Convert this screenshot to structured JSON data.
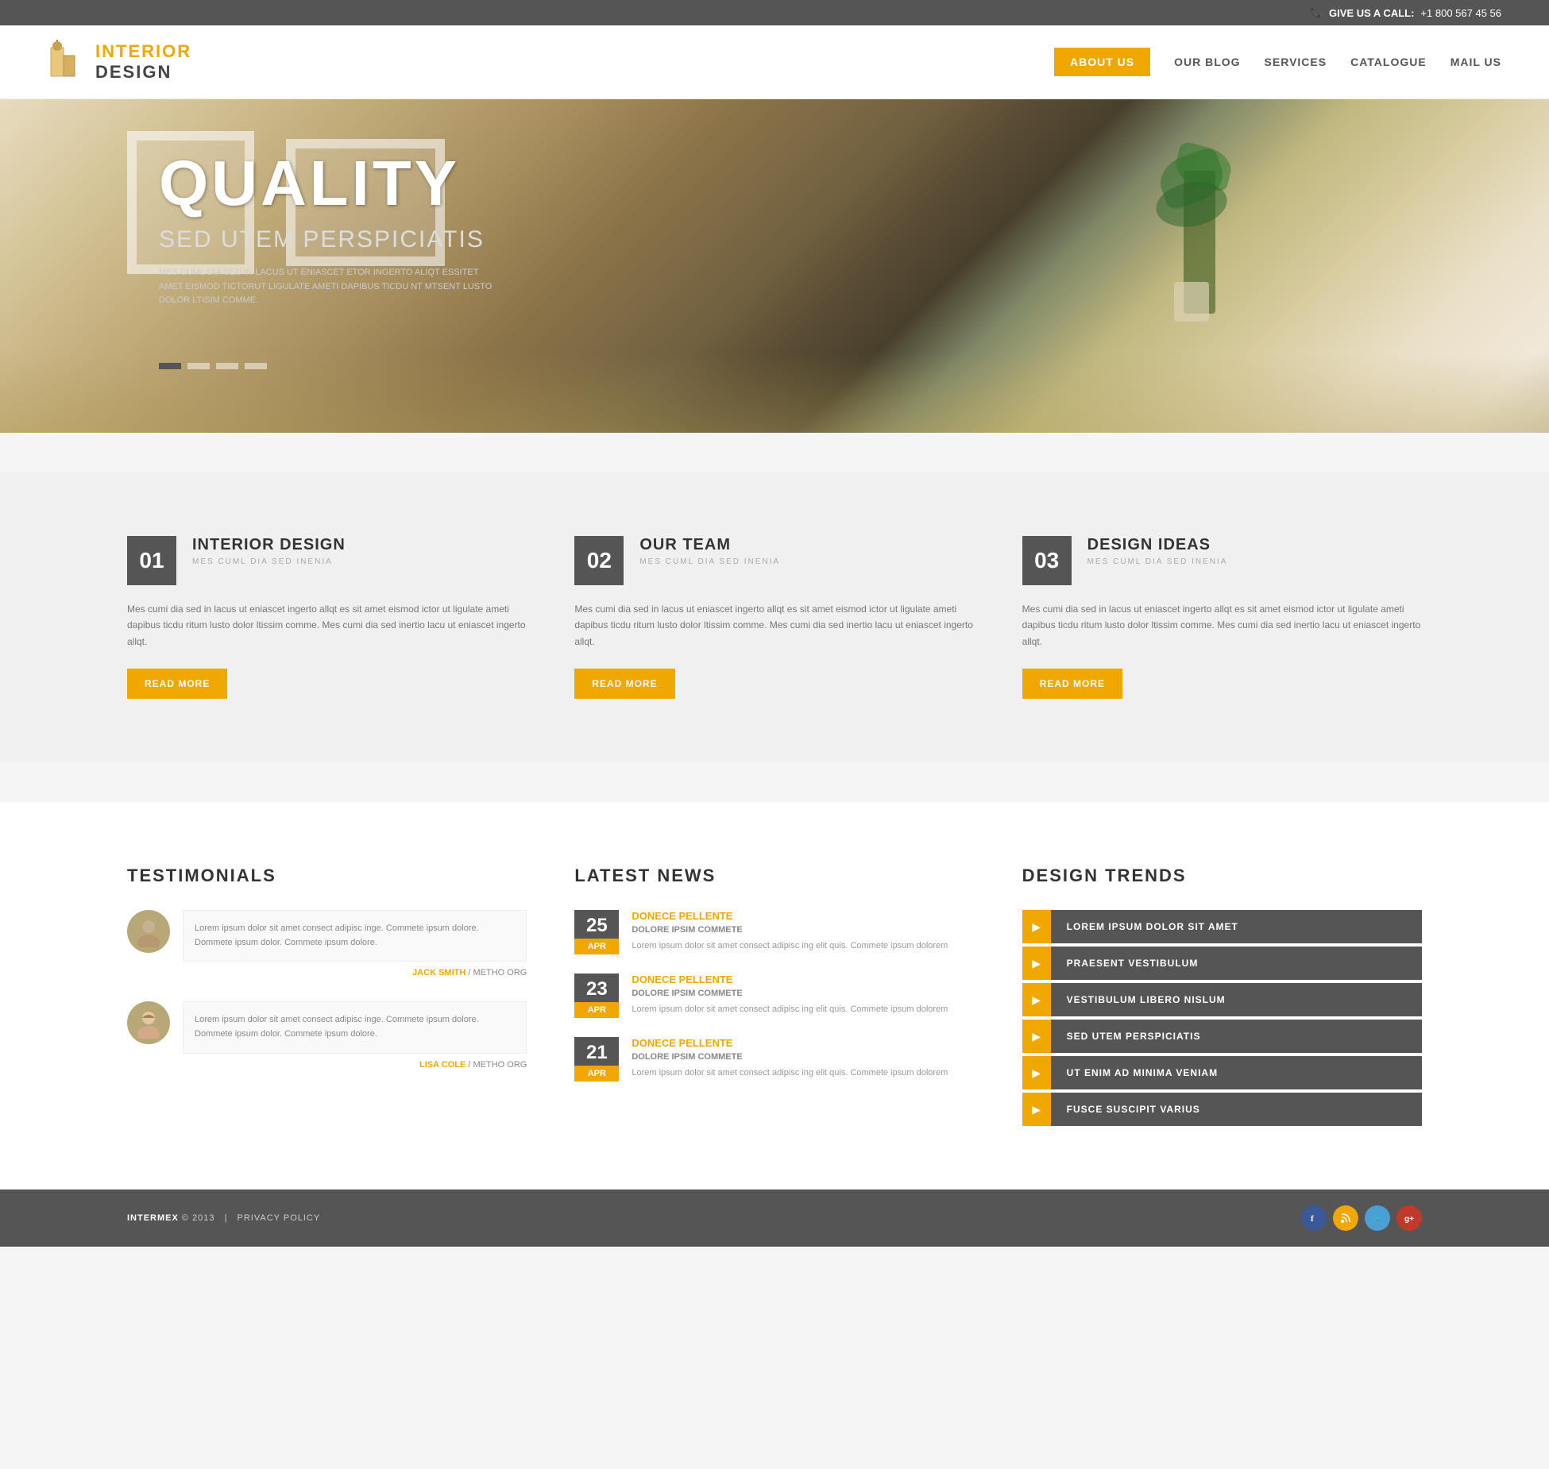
{
  "topbar": {
    "cta_label": "GIVE US A CALL:",
    "phone": "+1 800 567 45 56"
  },
  "header": {
    "brand_line1": "INTERIOR",
    "brand_line2": "DESIGN",
    "nav": [
      {
        "id": "about",
        "label": "ABOUT US",
        "active": true
      },
      {
        "id": "blog",
        "label": "OUR BLOG",
        "active": false
      },
      {
        "id": "services",
        "label": "SERVICES",
        "active": false
      },
      {
        "id": "catalogue",
        "label": "CATALOGUE",
        "active": false
      },
      {
        "id": "mail",
        "label": "MAIL US",
        "active": false
      }
    ]
  },
  "hero": {
    "title": "QUALITY",
    "subtitle": "SED UTEM PERSPICIATIS",
    "desc": "MES CUML DIA SED IN LACUS UT ENIASCET ETOR INGERTO ALIQT ESSITET AMET EISMOD TICTORUT LIGULATE AMETI DAPIBUS TICDU NT MTSENT LUSTO DOLOR LTISIM COMME.",
    "dots": [
      {
        "active": true
      },
      {
        "active": false
      },
      {
        "active": false
      },
      {
        "active": false
      }
    ]
  },
  "features": [
    {
      "number": "01",
      "title": "INTERIOR DESIGN",
      "subtitle": "MES CUML DIA SED INENIA",
      "text": "Mes cumi dia sed in lacus ut eniascet ingerto allqt es sit amet eismod ictor ut ligulate ameti dapibus ticdu ritum lusto dolor ltissim comme. Mes cumi dia sed inertio lacu ut eniascet ingerto allqt.",
      "btn_label": "READ MORE"
    },
    {
      "number": "02",
      "title": "OUR TEAM",
      "subtitle": "MES CUML DIA SED INENIA",
      "text": "Mes cumi dia sed in lacus ut eniascet ingerto allqt es sit amet eismod ictor ut ligulate ameti dapibus ticdu ritum lusto dolor ltissim comme. Mes cumi dia sed inertio lacu ut eniascet ingerto allqt.",
      "btn_label": "READ MORE"
    },
    {
      "number": "03",
      "title": "DESIGN IDEAS",
      "subtitle": "MES CUML DIA SED INENIA",
      "text": "Mes cumi dia sed in lacus ut eniascet ingerto allqt es sit amet eismod ictor ut ligulate ameti dapibus ticdu ritum lusto dolor ltissim comme. Mes cumi dia sed inertio lacu ut eniascet ingerto allqt.",
      "btn_label": "READ MORE"
    }
  ],
  "testimonials": {
    "section_title": "TESTIMONIALS",
    "items": [
      {
        "text": "Lorem ipsum dolor sit amet consect adipisc inge. Commete ipsum dolore. Dommete ipsum dolor. Commete ipsum dolore.",
        "name": "JACK SMITH",
        "org": "METHO ORG",
        "avatar_gender": "male"
      },
      {
        "text": "Lorem ipsum dolor sit amet consect adipisc inge. Commete ipsum dolore. Dommete ipsum dolor. Commete ipsum dolore.",
        "name": "LISA COLE",
        "org": "METHO ORG",
        "avatar_gender": "female"
      }
    ]
  },
  "latest_news": {
    "section_title": "LATEST NEWS",
    "items": [
      {
        "day": "25",
        "month": "APR",
        "link_label": "DONECE PELLENTE",
        "subtitle": "DOLORE IPSIM COMMETE",
        "text": "Lorem ipsum dolor sit amet consect adipisc ing elit quis. Commete ipsum dolorem"
      },
      {
        "day": "23",
        "month": "APR",
        "link_label": "DONECE PELLENTE",
        "subtitle": "DOLORE IPSIM COMMETE",
        "text": "Lorem ipsum dolor sit amet consect adipisc ing elit quis. Commete ipsum dolorem"
      },
      {
        "day": "21",
        "month": "APR",
        "link_label": "DONECE PELLENTE",
        "subtitle": "DOLORE IPSIM COMMETE",
        "text": "Lorem ipsum dolor sit amet consect adipisc ing elit quis. Commete ipsum dolorem"
      }
    ]
  },
  "design_trends": {
    "section_title": "DESIGN TRENDS",
    "items": [
      {
        "label": "LOREM IPSUM DOLOR SIT AMET"
      },
      {
        "label": "PRAESENT VESTIBULUM"
      },
      {
        "label": "VESTIBULUM LIBERO NISLUM"
      },
      {
        "label": "SED UTEM PERSPICIATIS"
      },
      {
        "label": "UT ENIM AD MINIMA VENIAM"
      },
      {
        "label": "FUSCE SUSCIPIT VARIUS"
      }
    ]
  },
  "footer": {
    "brand": "INTERMEX",
    "year": "© 2013",
    "sep": "|",
    "policy": "PRIVACY POLICY",
    "social": [
      {
        "name": "facebook",
        "icon": "f",
        "color": "#3b5998"
      },
      {
        "name": "rss",
        "icon": "r",
        "color": "#f0a800"
      },
      {
        "name": "twitter",
        "icon": "t",
        "color": "#4a9fd5"
      },
      {
        "name": "google",
        "icon": "g",
        "color": "#c0392b"
      }
    ]
  },
  "colors": {
    "accent": "#f0a800",
    "dark": "#555555",
    "text": "#777777"
  }
}
